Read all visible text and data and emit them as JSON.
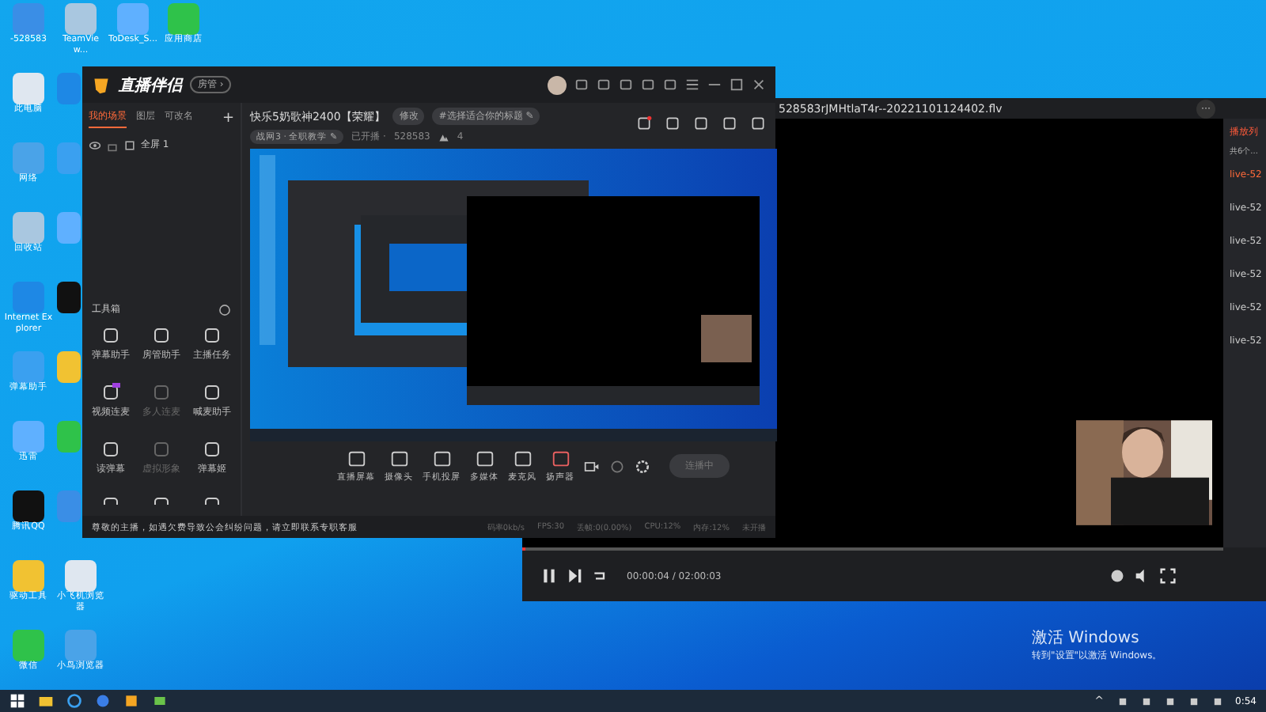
{
  "desktop": {
    "columns": [
      {
        "icons": [
          {
            "label": "-528583"
          },
          {
            "label": "此电脑"
          },
          {
            "label": "网络"
          },
          {
            "label": "回收站"
          },
          {
            "label": "Internet Explorer"
          },
          {
            "label": "弹幕助手"
          },
          {
            "label": "迅雷"
          },
          {
            "label": "腾讯QQ"
          },
          {
            "label": "驱动工具"
          },
          {
            "label": "微信"
          }
        ]
      },
      {
        "icons": [
          {
            "label": "TeamView..."
          },
          {
            "kind": "covered"
          },
          {
            "kind": "covered"
          },
          {
            "kind": "covered"
          },
          {
            "kind": "covered"
          },
          {
            "kind": "covered"
          },
          {
            "kind": "covered"
          },
          {
            "kind": "covered"
          },
          {
            "label": "小飞机浏览器"
          },
          {
            "label": "小鸟浏览器"
          }
        ]
      },
      {
        "icons": [
          {
            "label": "ToDesk_S..."
          }
        ]
      },
      {
        "icons": [
          {
            "label": "应用商店"
          }
        ]
      }
    ],
    "activation": {
      "title": "激活 Windows",
      "hint": "转到\"设置\"以激活 Windows。"
    }
  },
  "studio": {
    "app_name": "直播伴侣",
    "badge": "房管 ›",
    "scene_tabs": [
      {
        "label": "我的场景",
        "selected": true
      },
      {
        "label": "图层",
        "selected": false
      },
      {
        "label": "可改名",
        "selected": false
      }
    ],
    "add": "+",
    "scenes": [
      {
        "label": "全屏 1",
        "visible": true
      }
    ],
    "toolbox_title": "工具箱",
    "tools": [
      {
        "label": "弹幕助手",
        "disabled": false,
        "new": false
      },
      {
        "label": "房管助手",
        "disabled": false,
        "new": false
      },
      {
        "label": "主播任务",
        "disabled": false,
        "new": false
      },
      {
        "label": "视频连麦",
        "disabled": false,
        "new": true
      },
      {
        "label": "多人连麦",
        "disabled": true,
        "new": false
      },
      {
        "label": "喊麦助手",
        "disabled": false,
        "new": false
      },
      {
        "label": "读弹幕",
        "disabled": false,
        "new": false
      },
      {
        "label": "虚拟形象",
        "disabled": true,
        "new": false
      },
      {
        "label": "弹幕姬",
        "disabled": false,
        "new": false
      }
    ],
    "stream_title": "快乐5奶歌神2400【荣耀】",
    "edit": "修改",
    "topic": "#选择适合你的标题 ✎",
    "category": "战网3 · 全职教学 ✎",
    "status": "已开播 ·",
    "room_id": "528583",
    "viewers": "4",
    "controls": [
      "直播屏幕",
      "摄像头",
      "手机投屏",
      "多媒体",
      "麦克风",
      "扬声器"
    ],
    "live_button": "连播中",
    "notice": "尊敬的主播，如遇欠费导致公会纠纷问题，请立即联系专职客服",
    "stats": [
      "码率0kb/s",
      "FPS:30",
      "丢帧:0(0.00%)",
      "CPU:12%",
      "内存:12%",
      "未开播"
    ]
  },
  "player": {
    "title": "528583rJMHtlaT4r--20221101124402.flv",
    "more": "···",
    "playlist_title": "播放列",
    "playlist_count": "共6个...",
    "items": [
      {
        "label": "live-52",
        "selected": true
      },
      {
        "label": "live-52",
        "selected": false
      },
      {
        "label": "live-52",
        "selected": false
      },
      {
        "label": "live-52",
        "selected": false
      },
      {
        "label": "live-52",
        "selected": false
      },
      {
        "label": "live-52",
        "selected": false
      }
    ],
    "progress": {
      "level": 0.003
    },
    "time": "00:00:04 / 02:00:03"
  },
  "taskbar": {
    "clock": "0:54",
    "caret": "^"
  }
}
